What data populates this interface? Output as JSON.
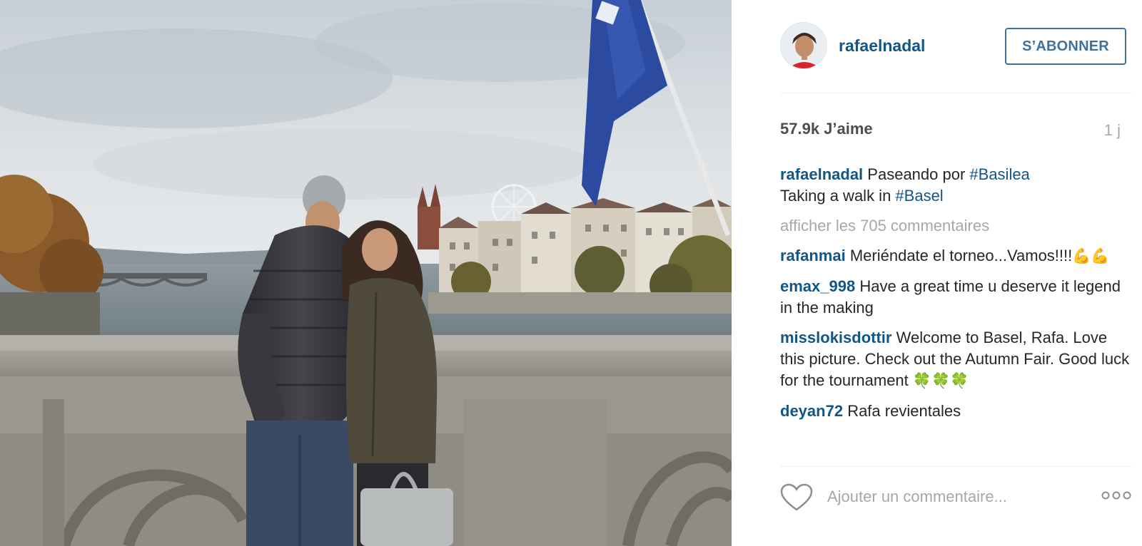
{
  "post": {
    "username": "rafaelnadal",
    "follow_label": "S’ABONNER",
    "likes": "57.9k J’aime",
    "age": "1 j"
  },
  "caption": {
    "user": "rafaelnadal",
    "line1_text": "Paseando por ",
    "line1_tag": "#Basilea",
    "line2_text": "Taking a walk in ",
    "line2_tag": "#Basel"
  },
  "view_all_comments": "afficher les 705 commentaires",
  "comments": [
    {
      "user": "rafanmai",
      "text": "Meriéndate el torneo...Vamos!!!!",
      "emoji": "💪💪"
    },
    {
      "user": "emax_998",
      "text": "Have a great time u deserve it legend in the making",
      "emoji": ""
    },
    {
      "user": "misslokisdottir",
      "text": "Welcome to Basel, Rafa. Love this picture. Check out the Autumn Fair. Good luck for the tournament",
      "emoji": "🍀🍀🍀"
    },
    {
      "user": "deyan72",
      "text": "Rafa revientales",
      "emoji": ""
    }
  ],
  "add_comment": {
    "placeholder": "Ajouter un commentaire..."
  },
  "icons": {
    "like": "heart-icon",
    "options": "more-options-icon"
  },
  "colors": {
    "link": "#125688",
    "follow": "#3f729b",
    "muted": "#a5a7aa"
  }
}
